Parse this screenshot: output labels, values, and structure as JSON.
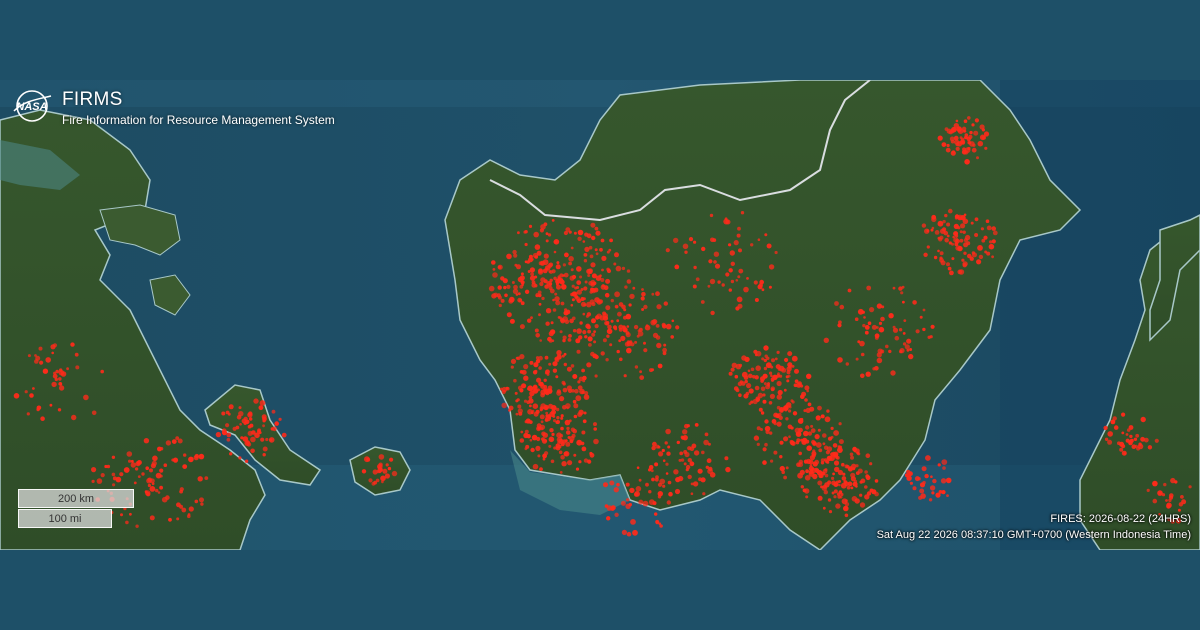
{
  "brand": {
    "logo_icon": "nasa-meatball-icon",
    "logo_text": "NASA",
    "title": "FIRMS",
    "subtitle": "Fire Information for Resource Management System"
  },
  "scale_bar": {
    "km_label": "200 km",
    "mi_label": "100 mi"
  },
  "status": {
    "fires_label": "FIRES: 2026-08-22 (24HRS)",
    "timestamp": "Sat Aug 22 2026 08:37:10 GMT+0700 (Western Indonesia Time)"
  },
  "map": {
    "base_layer": "satellite-imagery",
    "overlay_layer": "active-fire-detections",
    "fire_color": "#ff2a1a",
    "land_color": "#35522c",
    "water_color": "#1f4f68",
    "border_color": "#d9dde0"
  }
}
